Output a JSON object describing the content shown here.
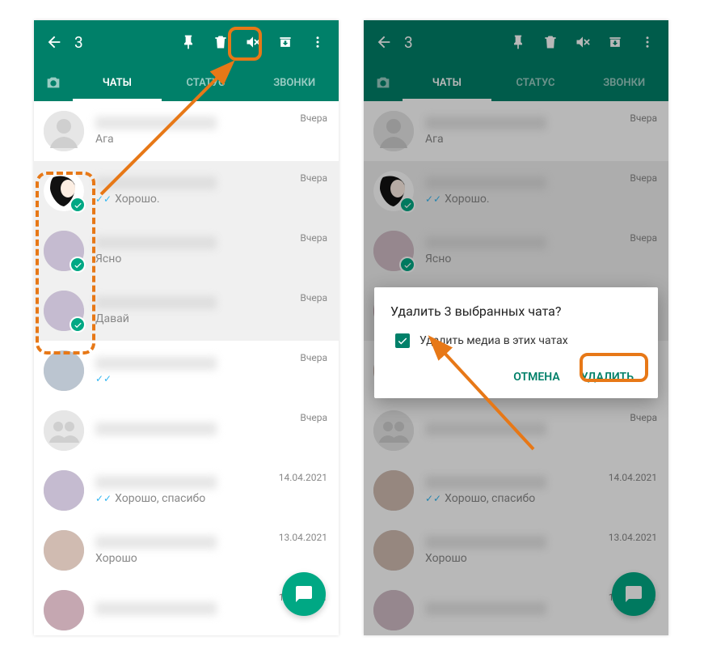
{
  "topbar": {
    "selected_count": "3"
  },
  "tabs": {
    "chats": "ЧАТЫ",
    "status": "СТАТУС",
    "calls": "ЗВОНКИ"
  },
  "times": {
    "yesterday": "Вчера",
    "d1": "14.04.2021",
    "d2": "13.04.2021"
  },
  "chats": [
    {
      "msg": "Ага",
      "time_key": "yesterday",
      "selected": false,
      "ticks": false,
      "avatar": "blank"
    },
    {
      "msg": "Хорошо.",
      "time_key": "yesterday",
      "selected": true,
      "ticks": true,
      "avatar": "hair"
    },
    {
      "msg": "Ясно",
      "time_key": "yesterday",
      "selected": true,
      "ticks": false,
      "avatar": "photo1"
    },
    {
      "msg": "Давай",
      "time_key": "yesterday",
      "selected": true,
      "ticks": false,
      "avatar": "photo2"
    },
    {
      "msg": "",
      "time_key": "yesterday",
      "selected": false,
      "ticks": true,
      "avatar": "photo3"
    },
    {
      "msg": "",
      "time_key": "yesterday",
      "selected": false,
      "ticks": false,
      "avatar": "group"
    },
    {
      "msg": "Хорошо, спасибо",
      "time_key": "d1",
      "selected": false,
      "ticks": true,
      "avatar": "photo4"
    },
    {
      "msg": "Хорошо",
      "time_key": "d2",
      "selected": false,
      "ticks": false,
      "avatar": "photo5"
    },
    {
      "msg": "",
      "time_key": "d2",
      "selected": false,
      "ticks": false,
      "avatar": "photo6"
    }
  ],
  "dialog": {
    "title": "Удалить 3 выбранных чата?",
    "checkbox_label": "Удалить медиа в этих чатах",
    "cancel": "ОТМЕНА",
    "delete": "УДАЛИТЬ"
  }
}
